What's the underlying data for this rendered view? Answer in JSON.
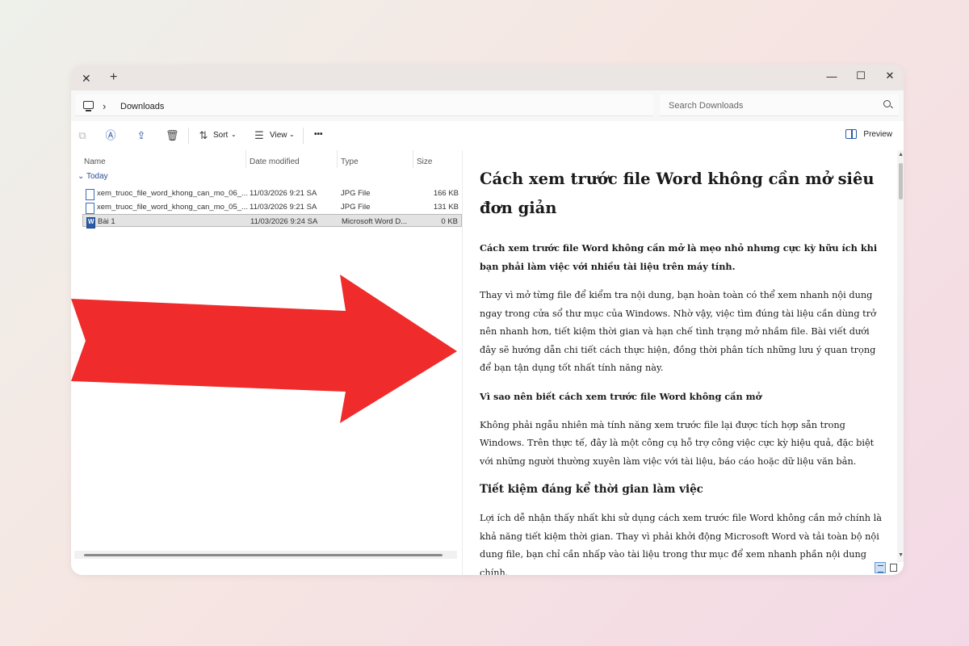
{
  "window": {
    "tab_close": "✕",
    "tab_new": "+",
    "minimize": "—",
    "maximize": "☐",
    "close": "✕"
  },
  "address": {
    "separator": "›",
    "location": "Downloads",
    "search_placeholder": "Search Downloads"
  },
  "toolbar": {
    "sort_label": "Sort",
    "view_label": "View",
    "more_label": "•••",
    "preview_label": "Preview"
  },
  "file_list": {
    "columns": [
      "Name",
      "Date modified",
      "Type",
      "Size"
    ],
    "group": "Today",
    "rows": [
      {
        "name": "xem_truoc_file_word_khong_can_mo_06_...",
        "date": "11/03/2026 9:21 SA",
        "type": "JPG File",
        "size": "166 KB",
        "icon": "image-file-icon",
        "selected": false
      },
      {
        "name": "xem_truoc_file_word_khong_can_mo_05_...",
        "date": "11/03/2026 9:21 SA",
        "type": "JPG File",
        "size": "131 KB",
        "icon": "image-file-icon",
        "selected": false
      },
      {
        "name": "Bài 1",
        "date": "11/03/2026 9:24 SA",
        "type": "Microsoft Word D...",
        "size": "0 KB",
        "icon": "word-file-icon",
        "selected": true
      }
    ]
  },
  "preview_doc": {
    "title": "Cách xem trước file Word không cần mở siêu đơn giản",
    "lead": "Cách xem trước file Word không cần mở là mẹo nhỏ nhưng cực kỳ hữu ích khi bạn phải làm việc với nhiều tài liệu trên máy tính.",
    "p1": "Thay vì mở từng file để kiểm tra nội dung, bạn hoàn toàn có thể xem nhanh nội dung ngay trong cửa sổ thư mục của Windows. Nhờ vậy, việc tìm đúng tài liệu cần dùng trở nên nhanh hơn, tiết kiệm thời gian và hạn chế tình trạng mở nhầm file. Bài viết dưới đây sẽ hướng dẫn chi tiết cách thực hiện, đồng thời phân tích những lưu ý quan trọng để bạn tận dụng tốt nhất tính năng này.",
    "h3": "Vì sao nên biết cách xem trước file Word không cần mở",
    "p2": "Không phải ngẫu nhiên mà tính năng xem trước file lại được tích hợp sẵn trong Windows. Trên thực tế, đây là một công cụ hỗ trợ công việc cực kỳ hiệu quả, đặc biệt với những người thường xuyên làm việc với tài liệu, báo cáo hoặc dữ liệu văn bản.",
    "h2": "Tiết kiệm đáng kể thời gian làm việc",
    "p3": "Lợi ích dễ nhận thấy nhất khi sử dụng cách xem trước file Word không cần mở chính là khả năng tiết kiệm thời gian. Thay vì phải khởi động Microsoft Word và tải toàn bộ nội dung file, bạn chỉ cần nhấp vào tài liệu trong thư mục để xem nhanh phần nội dung chính."
  },
  "colors": {
    "accent": "#2b5aa5",
    "arrow": "#ef2b2b",
    "selected_row": "#e3e3e3"
  }
}
